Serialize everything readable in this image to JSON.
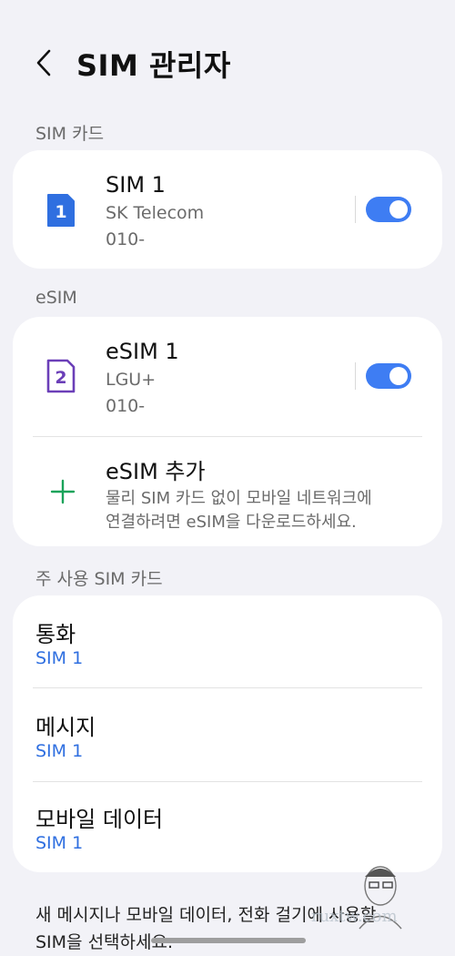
{
  "header": {
    "title": "SIM 관리자"
  },
  "sections": {
    "sim_cards": "SIM 카드",
    "esim": "eSIM",
    "primary": "주 사용 SIM 카드"
  },
  "sim1": {
    "badge": "1",
    "name": "SIM 1",
    "carrier": "SK Telecom",
    "number": "010-",
    "enabled": true
  },
  "esim1": {
    "badge": "2",
    "name": "eSIM 1",
    "carrier": "LGU+",
    "number": "010-",
    "enabled": true
  },
  "add_esim": {
    "title": "eSIM 추가",
    "desc_line1": "물리 SIM 카드 없이 모바일 네트워크에",
    "desc_line2": "연결하려면 eSIM을 다운로드하세요."
  },
  "preferences": [
    {
      "title": "통화",
      "value": "SIM 1"
    },
    {
      "title": "메시지",
      "value": "SIM 1"
    },
    {
      "title": "모바일 데이터",
      "value": "SIM 1"
    }
  ],
  "footer": {
    "line1": "새 메시지나 모바일 데이터, 전화 걸기에 사용할",
    "line2": "SIM을 선택하세요."
  },
  "watermark": "ruxtw.com",
  "colors": {
    "accent": "#3e7df3",
    "sim1_icon": "#2f6fe0",
    "esim_icon": "#6b3fb8",
    "add_icon": "#1aa35a",
    "link": "#2f6fe0"
  },
  "icons": {
    "back": "chevron-left-icon",
    "sim1": "sim-card-icon",
    "esim": "esim-card-icon",
    "add": "plus-icon"
  }
}
